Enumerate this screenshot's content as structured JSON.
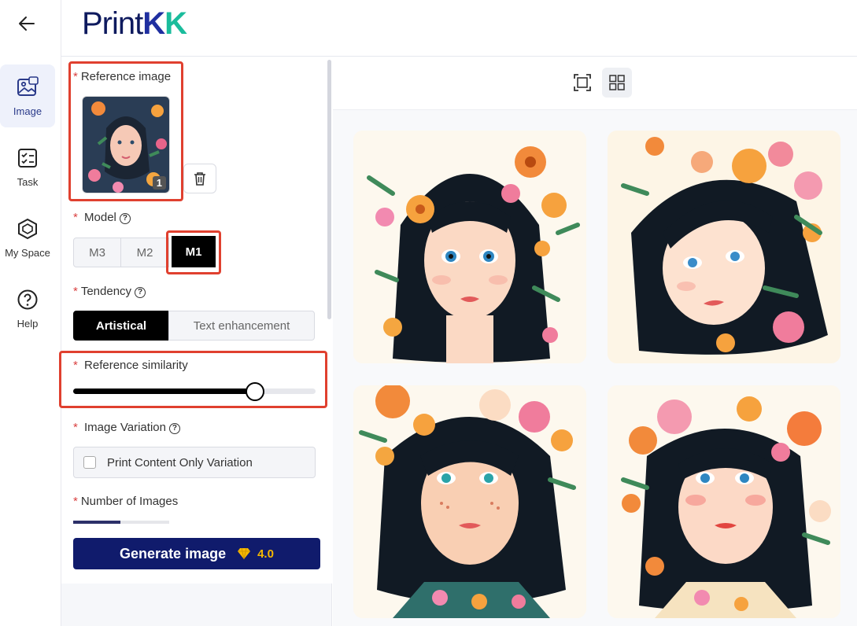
{
  "nav": {
    "items": [
      {
        "label": "Image",
        "icon": "image-icon"
      },
      {
        "label": "Task",
        "icon": "task-icon"
      },
      {
        "label": "My Space",
        "icon": "my-space-icon"
      },
      {
        "label": "Help",
        "icon": "help-icon"
      }
    ],
    "active": "Image"
  },
  "brand": {
    "prefix": "Print",
    "k1": "K",
    "k2": "K"
  },
  "form": {
    "reference_image": {
      "label": "Reference image",
      "count": "1"
    },
    "model": {
      "label": "Model",
      "options": [
        "M3",
        "M2",
        "M1"
      ],
      "selected": "M1"
    },
    "tendency": {
      "label": "Tendency",
      "options": [
        "Artistical",
        "Text enhancement"
      ],
      "selected": "Artistical"
    },
    "similarity": {
      "label": "Reference similarity",
      "value": 0.75
    },
    "variation": {
      "label": "Image Variation",
      "checkbox_label": "Print Content Only Variation",
      "checked": false
    },
    "num_images": {
      "label": "Number of Images"
    },
    "generate": {
      "label": "Generate image",
      "cost": "4.0"
    }
  },
  "colors": {
    "accent": "#101b6c",
    "highlight": "#e0402f",
    "cost": "#f5b800"
  },
  "gallery": {
    "images": [
      "portrait-1",
      "portrait-2",
      "portrait-3",
      "portrait-4"
    ]
  }
}
